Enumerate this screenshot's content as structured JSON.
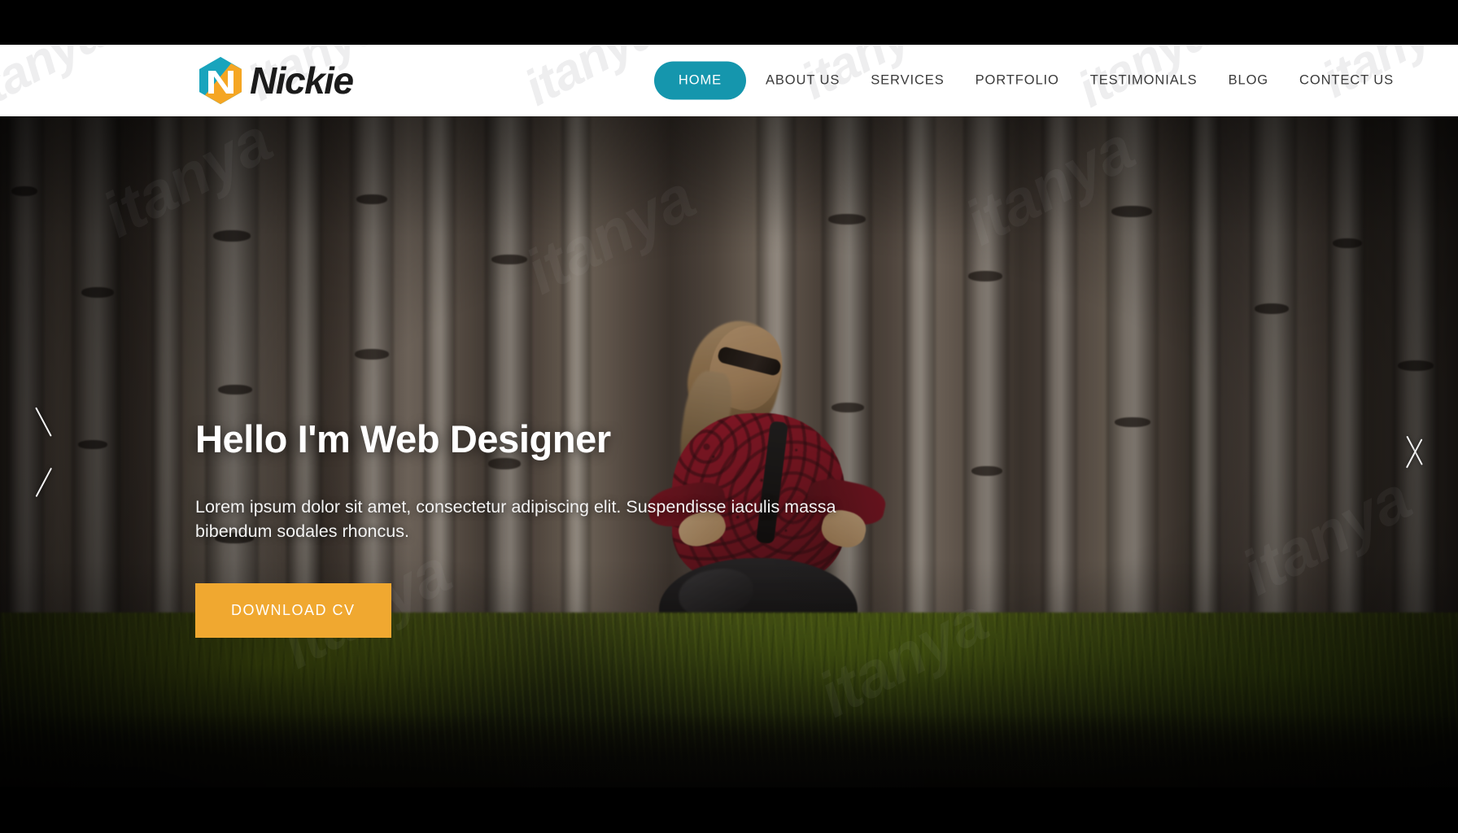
{
  "window": {
    "letterbox_color": "#000000"
  },
  "header": {
    "brand": {
      "name": "Nickie",
      "logo_icon": "nickie-hexagon-n-logo",
      "logo_colors": {
        "teal": "#19A4BD",
        "orange": "#F5A623",
        "letter": "#FFFFFF"
      }
    },
    "watermark_text": "itanya",
    "nav": {
      "active_index": 0,
      "active_bg": "#1596AD",
      "items": [
        {
          "label": "HOME",
          "active": true
        },
        {
          "label": "ABOUT US",
          "active": false
        },
        {
          "label": "SERVICES",
          "active": false
        },
        {
          "label": "PORTFOLIO",
          "active": false
        },
        {
          "label": "TESTIMONIALS",
          "active": false
        },
        {
          "label": "BLOG",
          "active": false
        },
        {
          "label": "CONTECT US",
          "active": false
        }
      ]
    }
  },
  "hero": {
    "background_scene": "birch-forest-photo",
    "title": "Hello I'm Web Designer",
    "subtitle": "Lorem ipsum dolor sit amet, consectetur adipiscing elit. Suspendisse iaculis massa bibendum sodales rhoncus.",
    "cta_label": "DOWNLOAD CV",
    "cta_color": "#F0A830",
    "prev_icon": "chevron-left-icon",
    "next_icon": "chevron-right-icon",
    "watermark_text": "itanya"
  }
}
